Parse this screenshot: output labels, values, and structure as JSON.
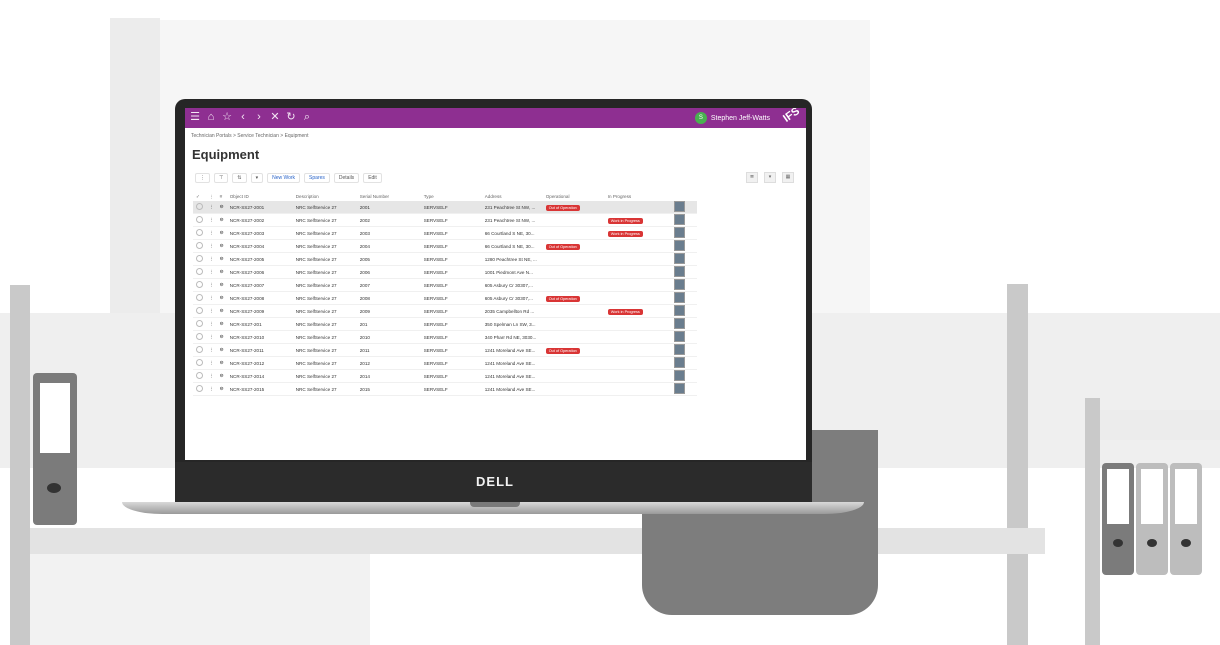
{
  "app": {
    "title": "Equipment",
    "breadcrumb": "Technician Portals > Service Technician > Equipment",
    "user": {
      "name": "Stephen Jeff-Watts",
      "initial": "S"
    },
    "brand": "IFS",
    "device_brand": "DELL",
    "accent": "#8e2f91"
  },
  "toolbar": {
    "new_work": "New Work",
    "spares": "Spares",
    "details": "Details",
    "edit": "Edit"
  },
  "table": {
    "headers": [
      "Object ID",
      "Description",
      "Serial Number",
      "Type",
      "Address",
      "Operational",
      "In Progress"
    ],
    "rows": [
      {
        "id": "NCR-SS27-2001",
        "desc": "NRC SelfService 27",
        "serial": "2001",
        "type": "SERVSELF",
        "addr": "231 Peachtree St NW, ...",
        "status": "Out of Operation",
        "progress": ""
      },
      {
        "id": "NCR-SS27-2002",
        "desc": "NRC SelfService 27",
        "serial": "2002",
        "type": "SERVSELF",
        "addr": "231 Peachtree St NW, ...",
        "status": "",
        "progress": "Work in Progress"
      },
      {
        "id": "NCR-SS27-2003",
        "desc": "NRC SelfService 27",
        "serial": "2003",
        "type": "SERVSELF",
        "addr": "66 Courtland S NE, 30...",
        "status": "",
        "progress": "Work in Progress"
      },
      {
        "id": "NCR-SS27-2004",
        "desc": "NRC SelfService 27",
        "serial": "2004",
        "type": "SERVSELF",
        "addr": "66 Courtland S NE, 30...",
        "status": "Out of Operation",
        "progress": ""
      },
      {
        "id": "NCR-SS27-2005",
        "desc": "NRC SelfService 27",
        "serial": "2005",
        "type": "SERVSELF",
        "addr": "1280 Peachtree St NE, ...",
        "status": "",
        "progress": ""
      },
      {
        "id": "NCR-SS27-2006",
        "desc": "NRC SelfService 27",
        "serial": "2006",
        "type": "SERVSELF",
        "addr": "1001 Piedmont Ave N...",
        "status": "",
        "progress": ""
      },
      {
        "id": "NCR-SS27-2007",
        "desc": "NRC SelfService 27",
        "serial": "2007",
        "type": "SERVSELF",
        "addr": "605 Asbury Cr 30307,...",
        "status": "",
        "progress": ""
      },
      {
        "id": "NCR-SS27-2008",
        "desc": "NRC SelfService 27",
        "serial": "2008",
        "type": "SERVSELF",
        "addr": "605 Asbury Cr 30307,...",
        "status": "Out of Operation",
        "progress": ""
      },
      {
        "id": "NCR-SS27-2009",
        "desc": "NRC SelfService 27",
        "serial": "2009",
        "type": "SERVSELF",
        "addr": "2035 Campbellton Rd ...",
        "status": "",
        "progress": "Work in Progress"
      },
      {
        "id": "NCR-SS27-201",
        "desc": "NRC SelfService 27",
        "serial": "201",
        "type": "SERVSELF",
        "addr": "350 Spelman Ln SW, 3...",
        "status": "",
        "progress": ""
      },
      {
        "id": "NCR-SS27-2010",
        "desc": "NRC SelfService 27",
        "serial": "2010",
        "type": "SERVSELF",
        "addr": "340 Pharr Rd NE, 3030...",
        "status": "",
        "progress": ""
      },
      {
        "id": "NCR-SS27-2011",
        "desc": "NRC SelfService 27",
        "serial": "2011",
        "type": "SERVSELF",
        "addr": "1241 Moreland Ave SE...",
        "status": "Out of Operation",
        "progress": ""
      },
      {
        "id": "NCR-SS27-2012",
        "desc": "NRC SelfService 27",
        "serial": "2012",
        "type": "SERVSELF",
        "addr": "1241 Moreland Ave SE...",
        "status": "",
        "progress": ""
      },
      {
        "id": "NCR-SS27-2014",
        "desc": "NRC SelfService 27",
        "serial": "2014",
        "type": "SERVSELF",
        "addr": "1241 Moreland Ave SE...",
        "status": "",
        "progress": ""
      },
      {
        "id": "NCR-SS27-2015",
        "desc": "NRC SelfService 27",
        "serial": "2015",
        "type": "SERVSELF",
        "addr": "1241 Moreland Ave SE...",
        "status": "",
        "progress": ""
      }
    ]
  }
}
